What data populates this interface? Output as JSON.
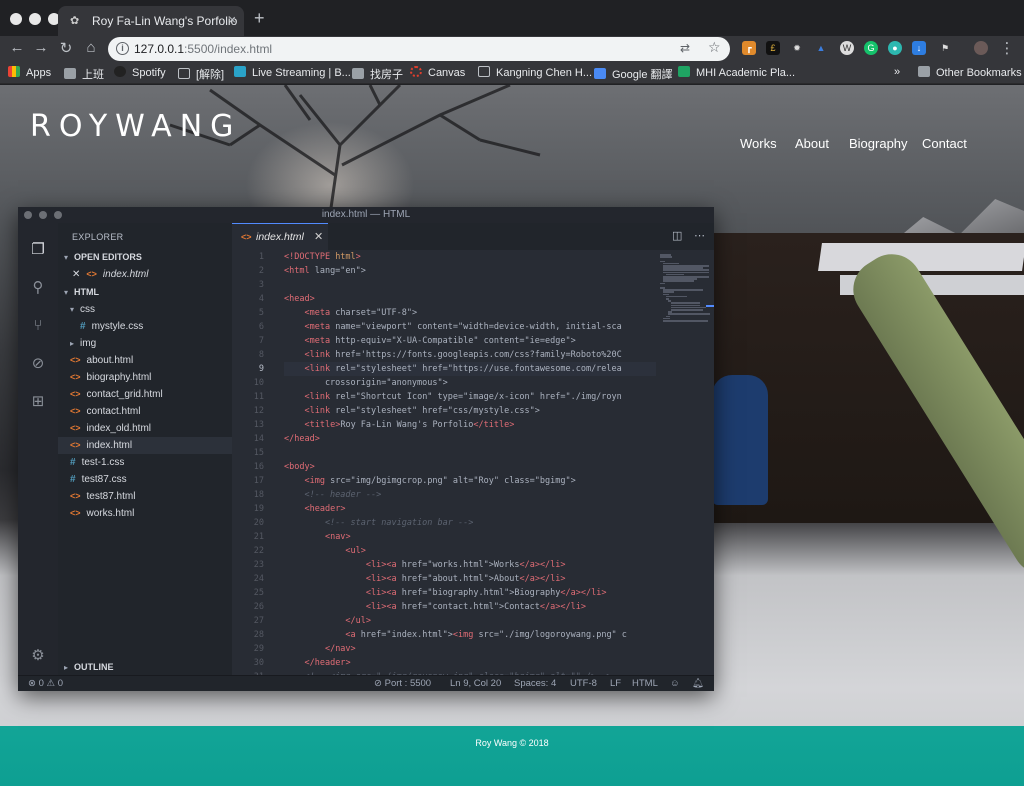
{
  "browser": {
    "tab_title": "Roy Fa-Lin Wang's Porfolio",
    "tab_close": "×",
    "new_tab": "+",
    "url_host": "127.0.0.1",
    "url_rest": ":5500/index.html",
    "bookmarks": [
      "Apps",
      "上班",
      "Spotify",
      "[解除]",
      "Live Streaming | B...",
      "找房子",
      "Canvas",
      "Kangning Chen H...",
      "Google 翻譯",
      "MHI Academic Pla..."
    ],
    "other_bookmarks": "Other Bookmarks",
    "more": "»"
  },
  "site": {
    "logo": "ROYWANG",
    "nav": [
      "Works",
      "About",
      "Biography",
      "Contact"
    ],
    "footer": "Roy Wang © 2018"
  },
  "vscode": {
    "window_title": "index.html — HTML",
    "explorer_title": "EXPLORER",
    "open_editors": "OPEN EDITORS",
    "open_file": "index.html",
    "folder_html": "HTML",
    "outline": "OUTLINE",
    "tree": [
      {
        "label": "css",
        "kind": "folder-open",
        "indent": 1
      },
      {
        "label": "mystyle.css",
        "kind": "css",
        "indent": 2
      },
      {
        "label": "img",
        "kind": "folder",
        "indent": 1
      },
      {
        "label": "about.html",
        "kind": "html",
        "indent": 1
      },
      {
        "label": "biography.html",
        "kind": "html",
        "indent": 1
      },
      {
        "label": "contact_grid.html",
        "kind": "html",
        "indent": 1
      },
      {
        "label": "contact.html",
        "kind": "html",
        "indent": 1
      },
      {
        "label": "index_old.html",
        "kind": "html",
        "indent": 1
      },
      {
        "label": "index.html",
        "kind": "html",
        "indent": 1,
        "selected": true
      },
      {
        "label": "test-1.css",
        "kind": "css",
        "indent": 1
      },
      {
        "label": "test87.css",
        "kind": "css",
        "indent": 1
      },
      {
        "label": "test87.html",
        "kind": "html",
        "indent": 1
      },
      {
        "label": "works.html",
        "kind": "html",
        "indent": 1
      }
    ],
    "editor_tab": "index.html",
    "current_line": 9,
    "code": [
      "<!DOCTYPE html>",
      "<html lang=\"en\">",
      "",
      "<head>",
      "    <meta charset=\"UTF-8\">",
      "    <meta name=\"viewport\" content=\"width=device-width, initial-sca",
      "    <meta http-equiv=\"X-UA-Compatible\" content=\"ie=edge\">",
      "    <link href='https://fonts.googleapis.com/css?family=Roboto%20C",
      "    <link rel=\"stylesheet\" href=\"https://use.fontawesome.com/relea",
      "        crossorigin=\"anonymous\">",
      "    <link rel=\"Shortcut Icon\" type=\"image/x-icon\" href=\"./img/royn",
      "    <link rel=\"stylesheet\" href=\"css/mystyle.css\">",
      "    <title>Roy Fa-Lin Wang's Porfolio</title>",
      "</head>",
      "",
      "<body>",
      "    <img src=\"img/bgimgcrop.png\" alt=\"Roy\" class=\"bgimg\">",
      "    <!-- header -->",
      "    <header>",
      "        <!-- start navigation bar -->",
      "        <nav>",
      "            <ul>",
      "                <li><a href=\"works.html\">Works</a></li>",
      "                <li><a href=\"about.html\">About</a></li>",
      "                <li><a href=\"biography.html\">Biography</a></li>",
      "                <li><a href=\"contact.html\">Contact</a></li>",
      "            </ul>",
      "            <a href=\"index.html\"><img src=\"./img/logoroywang.png\" c",
      "        </nav>",
      "    </header>",
      "    <!-- <img src=\"./img/roysnow.jpg\" class=\"bgimg\" alt=\"\" />-->"
    ],
    "status": {
      "errors": "0",
      "warnings": "0",
      "port": "Port : 5500",
      "position": "Ln 9, Col 20",
      "spaces": "Spaces: 4",
      "encoding": "UTF-8",
      "eol": "LF",
      "language": "HTML"
    }
  }
}
